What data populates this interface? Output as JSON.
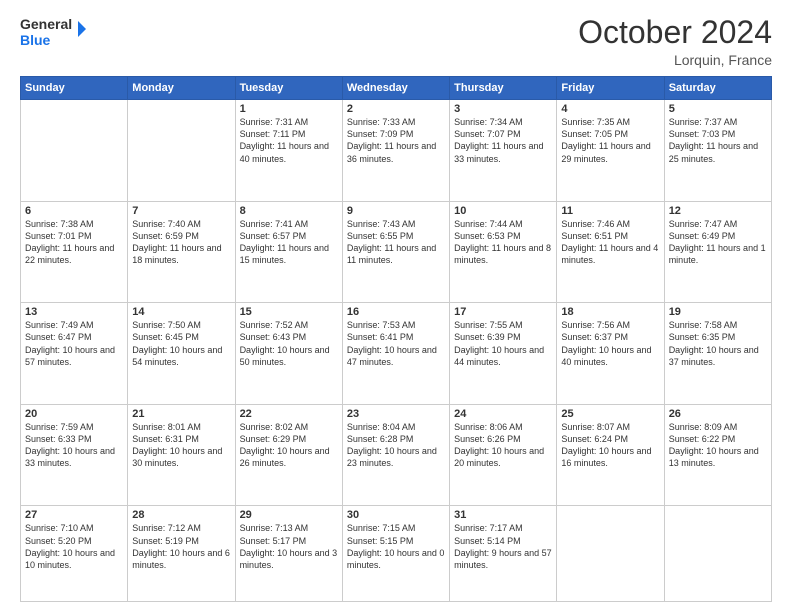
{
  "header": {
    "logo_line1": "General",
    "logo_line2": "Blue",
    "month": "October 2024",
    "location": "Lorquin, France"
  },
  "weekdays": [
    "Sunday",
    "Monday",
    "Tuesday",
    "Wednesday",
    "Thursday",
    "Friday",
    "Saturday"
  ],
  "rows": [
    [
      {
        "day": "",
        "info": ""
      },
      {
        "day": "",
        "info": ""
      },
      {
        "day": "1",
        "info": "Sunrise: 7:31 AM\nSunset: 7:11 PM\nDaylight: 11 hours and 40 minutes."
      },
      {
        "day": "2",
        "info": "Sunrise: 7:33 AM\nSunset: 7:09 PM\nDaylight: 11 hours and 36 minutes."
      },
      {
        "day": "3",
        "info": "Sunrise: 7:34 AM\nSunset: 7:07 PM\nDaylight: 11 hours and 33 minutes."
      },
      {
        "day": "4",
        "info": "Sunrise: 7:35 AM\nSunset: 7:05 PM\nDaylight: 11 hours and 29 minutes."
      },
      {
        "day": "5",
        "info": "Sunrise: 7:37 AM\nSunset: 7:03 PM\nDaylight: 11 hours and 25 minutes."
      }
    ],
    [
      {
        "day": "6",
        "info": "Sunrise: 7:38 AM\nSunset: 7:01 PM\nDaylight: 11 hours and 22 minutes."
      },
      {
        "day": "7",
        "info": "Sunrise: 7:40 AM\nSunset: 6:59 PM\nDaylight: 11 hours and 18 minutes."
      },
      {
        "day": "8",
        "info": "Sunrise: 7:41 AM\nSunset: 6:57 PM\nDaylight: 11 hours and 15 minutes."
      },
      {
        "day": "9",
        "info": "Sunrise: 7:43 AM\nSunset: 6:55 PM\nDaylight: 11 hours and 11 minutes."
      },
      {
        "day": "10",
        "info": "Sunrise: 7:44 AM\nSunset: 6:53 PM\nDaylight: 11 hours and 8 minutes."
      },
      {
        "day": "11",
        "info": "Sunrise: 7:46 AM\nSunset: 6:51 PM\nDaylight: 11 hours and 4 minutes."
      },
      {
        "day": "12",
        "info": "Sunrise: 7:47 AM\nSunset: 6:49 PM\nDaylight: 11 hours and 1 minute."
      }
    ],
    [
      {
        "day": "13",
        "info": "Sunrise: 7:49 AM\nSunset: 6:47 PM\nDaylight: 10 hours and 57 minutes."
      },
      {
        "day": "14",
        "info": "Sunrise: 7:50 AM\nSunset: 6:45 PM\nDaylight: 10 hours and 54 minutes."
      },
      {
        "day": "15",
        "info": "Sunrise: 7:52 AM\nSunset: 6:43 PM\nDaylight: 10 hours and 50 minutes."
      },
      {
        "day": "16",
        "info": "Sunrise: 7:53 AM\nSunset: 6:41 PM\nDaylight: 10 hours and 47 minutes."
      },
      {
        "day": "17",
        "info": "Sunrise: 7:55 AM\nSunset: 6:39 PM\nDaylight: 10 hours and 44 minutes."
      },
      {
        "day": "18",
        "info": "Sunrise: 7:56 AM\nSunset: 6:37 PM\nDaylight: 10 hours and 40 minutes."
      },
      {
        "day": "19",
        "info": "Sunrise: 7:58 AM\nSunset: 6:35 PM\nDaylight: 10 hours and 37 minutes."
      }
    ],
    [
      {
        "day": "20",
        "info": "Sunrise: 7:59 AM\nSunset: 6:33 PM\nDaylight: 10 hours and 33 minutes."
      },
      {
        "day": "21",
        "info": "Sunrise: 8:01 AM\nSunset: 6:31 PM\nDaylight: 10 hours and 30 minutes."
      },
      {
        "day": "22",
        "info": "Sunrise: 8:02 AM\nSunset: 6:29 PM\nDaylight: 10 hours and 26 minutes."
      },
      {
        "day": "23",
        "info": "Sunrise: 8:04 AM\nSunset: 6:28 PM\nDaylight: 10 hours and 23 minutes."
      },
      {
        "day": "24",
        "info": "Sunrise: 8:06 AM\nSunset: 6:26 PM\nDaylight: 10 hours and 20 minutes."
      },
      {
        "day": "25",
        "info": "Sunrise: 8:07 AM\nSunset: 6:24 PM\nDaylight: 10 hours and 16 minutes."
      },
      {
        "day": "26",
        "info": "Sunrise: 8:09 AM\nSunset: 6:22 PM\nDaylight: 10 hours and 13 minutes."
      }
    ],
    [
      {
        "day": "27",
        "info": "Sunrise: 7:10 AM\nSunset: 5:20 PM\nDaylight: 10 hours and 10 minutes."
      },
      {
        "day": "28",
        "info": "Sunrise: 7:12 AM\nSunset: 5:19 PM\nDaylight: 10 hours and 6 minutes."
      },
      {
        "day": "29",
        "info": "Sunrise: 7:13 AM\nSunset: 5:17 PM\nDaylight: 10 hours and 3 minutes."
      },
      {
        "day": "30",
        "info": "Sunrise: 7:15 AM\nSunset: 5:15 PM\nDaylight: 10 hours and 0 minutes."
      },
      {
        "day": "31",
        "info": "Sunrise: 7:17 AM\nSunset: 5:14 PM\nDaylight: 9 hours and 57 minutes."
      },
      {
        "day": "",
        "info": ""
      },
      {
        "day": "",
        "info": ""
      }
    ]
  ]
}
